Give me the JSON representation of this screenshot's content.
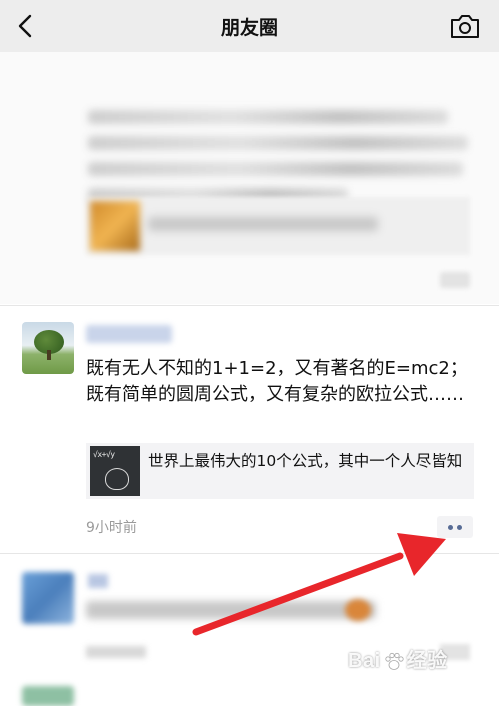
{
  "navbar": {
    "title": "朋友圈",
    "back_icon": "chevron-left-icon",
    "camera_icon": "camera-icon"
  },
  "post": {
    "text": "既有无人不知的1+1=2，又有著名的E=mc2；既有简单的圆周公式，又有复杂的欧拉公式……",
    "link_card": {
      "title": "世界上最伟大的10个公式，其中一个人尽皆知",
      "thumb_text": "√x+√y"
    },
    "timestamp": "9小时前",
    "more_icon": "more-dots-icon"
  },
  "annotation": {
    "arrow_color": "#e8262b"
  },
  "watermark": {
    "text_left": "Bai",
    "text_right": "经验"
  },
  "colors": {
    "navbar_bg": "#ededed",
    "link_blue": "#576b95",
    "time_gray": "#9b9b9b"
  }
}
